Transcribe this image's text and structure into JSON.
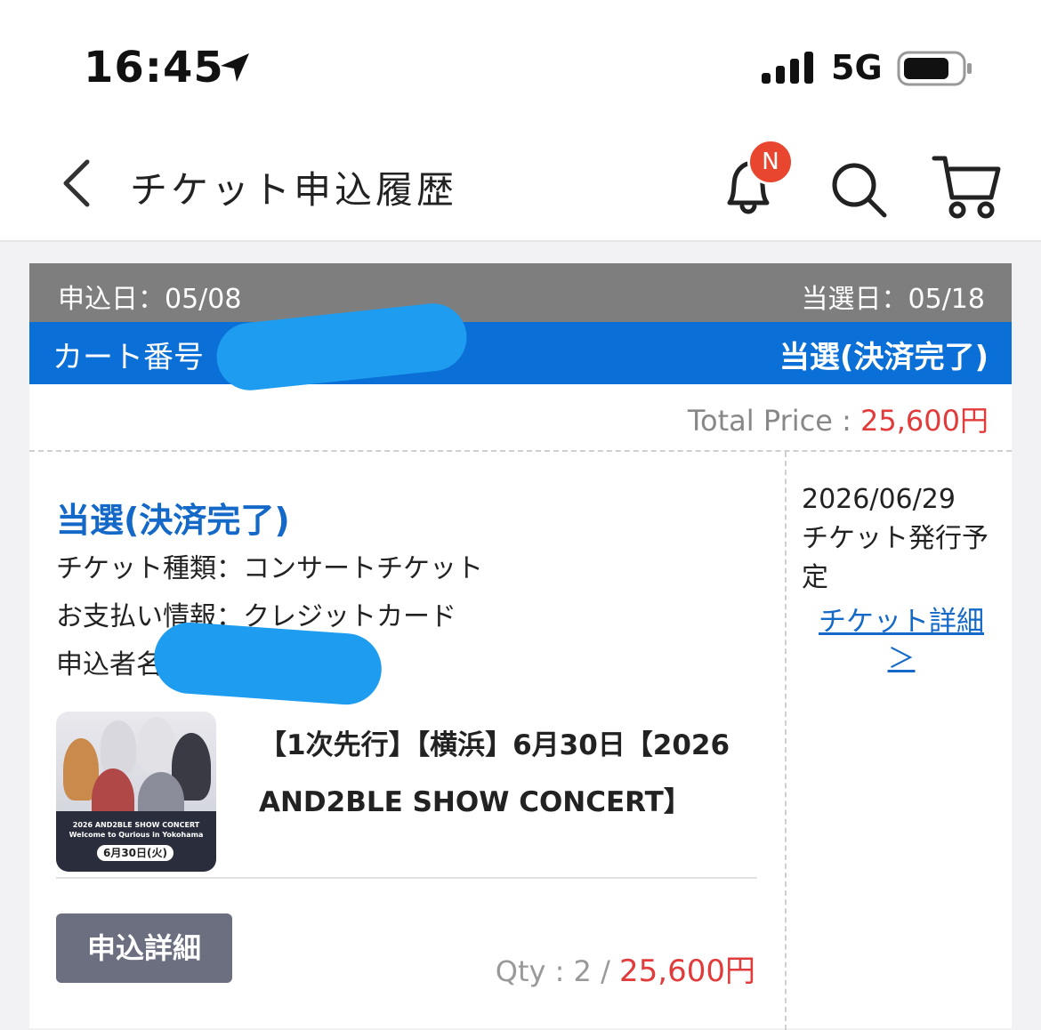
{
  "status_bar": {
    "time": "16:45",
    "network": "5G"
  },
  "header": {
    "title": "チケット申込履歴",
    "badge": "N"
  },
  "card": {
    "apply_date": "申込日：05/08",
    "win_date": "当選日：05/18",
    "cart_label": "カート番号",
    "status": "当選(決済完了)",
    "total_label": "Total Price : ",
    "total_value": "25,600円",
    "status_main": "当選(決済完了)",
    "ticket_type": "チケット種類：コンサートチケット",
    "payment": "お支払い情報：クレジットカード",
    "applicant_label": "申込者名",
    "product_title": "【1次先行】【横浜】6月30日【2026 AND2BLE SHOW CONCERT】",
    "thumb_caption": "2026 AND2BLE SHOW CONCERT Welcome to Qurious in Yokohama",
    "thumb_date": "6月30日(火)",
    "detail_button": "申込詳細",
    "qty_label": "Qty : 2 / ",
    "qty_price": "25,600円",
    "issue_date": "2026/06/29",
    "issue_text": "チケット発行予定",
    "ticket_link": "チケット詳細 ＞"
  },
  "colors": {
    "blue_bar": "#0a6fd6",
    "status_blue": "#1469c8",
    "price_red": "#e23b3b",
    "badge_red": "#e8462f",
    "button_gray": "#6c6f80"
  }
}
